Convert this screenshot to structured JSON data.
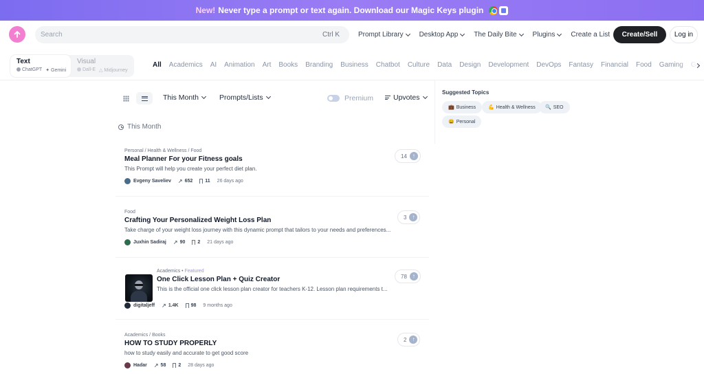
{
  "banner": {
    "new_label": "New!",
    "text": "Never type a prompt or text again. Download our Magic Keys plugin"
  },
  "header": {
    "search_placeholder": "Search",
    "search_shortcut": "Ctrl K",
    "nav": [
      "Prompt Library",
      "Desktop App",
      "The Daily Bite",
      "Plugins"
    ],
    "create_list": "Create a List",
    "create_sell": "Create/Sell",
    "login": "Log in"
  },
  "modes": {
    "text": {
      "title": "Text",
      "subs": [
        "ChatGPT",
        "Gemini"
      ]
    },
    "visual": {
      "title": "Visual",
      "subs": [
        "Dall-E",
        "Midjourney"
      ]
    }
  },
  "categories": [
    "All",
    "Academics",
    "AI",
    "Animation",
    "Art",
    "Books",
    "Branding",
    "Business",
    "Chatbot",
    "Culture",
    "Data",
    "Design",
    "Development",
    "DevOps",
    "Fantasy",
    "Financial",
    "Food",
    "Gaming",
    "Generative"
  ],
  "toolbar": {
    "period": "This Month",
    "type": "Prompts/Lists",
    "premium": "Premium",
    "sort": "Upvotes"
  },
  "section_label": "This Month",
  "cards": [
    {
      "crumb": "Personal / Health & Wellness / Food",
      "title": "Meal Planner For your Fitness goals",
      "desc": "This Prompt will help you create your perfect diet plan.",
      "author": "Evgeny Saveliev",
      "views": "652",
      "saves": "11",
      "time": "26 days ago",
      "votes": "14"
    },
    {
      "crumb": "Food",
      "title": "Crafting Your Personalized Weight Loss Plan",
      "desc": "Take charge of your weight loss journey with this dynamic prompt that tailors to your needs and preferences...",
      "author": "Juxhin Sadiraj",
      "views": "90",
      "saves": "2",
      "time": "21 days ago",
      "votes": "3"
    },
    {
      "crumb": "Academics",
      "featured": "Featured",
      "title": "One Click Lesson Plan + Quiz Creator",
      "desc": "This is the official one click lesson plan creator for teachers K-12. Lesson plan requirements t...",
      "author": "digitaljeff",
      "views": "1.4K",
      "saves": "98",
      "time": "9 months ago",
      "votes": "78"
    },
    {
      "crumb": "Academics / Books",
      "title": "HOW TO STUDY PROPERLY",
      "desc": "how to study easily and accurate to get good score",
      "author": "Hadar",
      "views": "58",
      "saves": "2",
      "time": "28 days ago",
      "votes": "2"
    }
  ],
  "sidebar": {
    "title": "Suggested Topics",
    "topics": [
      {
        "emoji": "💼",
        "label": "Business"
      },
      {
        "emoji": "💪",
        "label": "Health & Wellness"
      },
      {
        "emoji": "🔍",
        "label": "SEO"
      },
      {
        "emoji": "😀",
        "label": "Personal"
      }
    ]
  },
  "colors": {
    "banner": "#8a6ff2",
    "primary_button": "#1f2125",
    "logo": "#f27fd0",
    "upvote": "#a5b4cc"
  }
}
